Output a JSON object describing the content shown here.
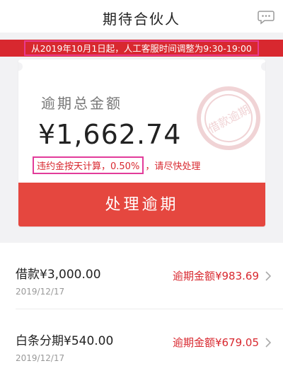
{
  "header": {
    "title": "期待合伙人",
    "chat_icon": "chat-bubble-icon"
  },
  "notice": {
    "text": "从2019年10月1日起，人工客服时间调整为9:30-19:00"
  },
  "card": {
    "label": "逾期总金额",
    "amount": "¥1,662.74",
    "stamp_text": "借款逾期",
    "penalty_highlight": "违约金按天计算，0.50%",
    "penalty_tail": "，请尽快处理",
    "action_label": "处理逾期"
  },
  "loans": [
    {
      "name": "借款¥3,000.00",
      "date": "2019/12/17",
      "overdue": "逾期金额¥983.69"
    },
    {
      "name": "白条分期¥540.00",
      "date": "2019/12/17",
      "overdue": "逾期金额¥679.05"
    }
  ],
  "colors": {
    "brand_red": "#d8282f",
    "button_red": "#e5473f",
    "highlight_pink": "#e23c9a"
  }
}
